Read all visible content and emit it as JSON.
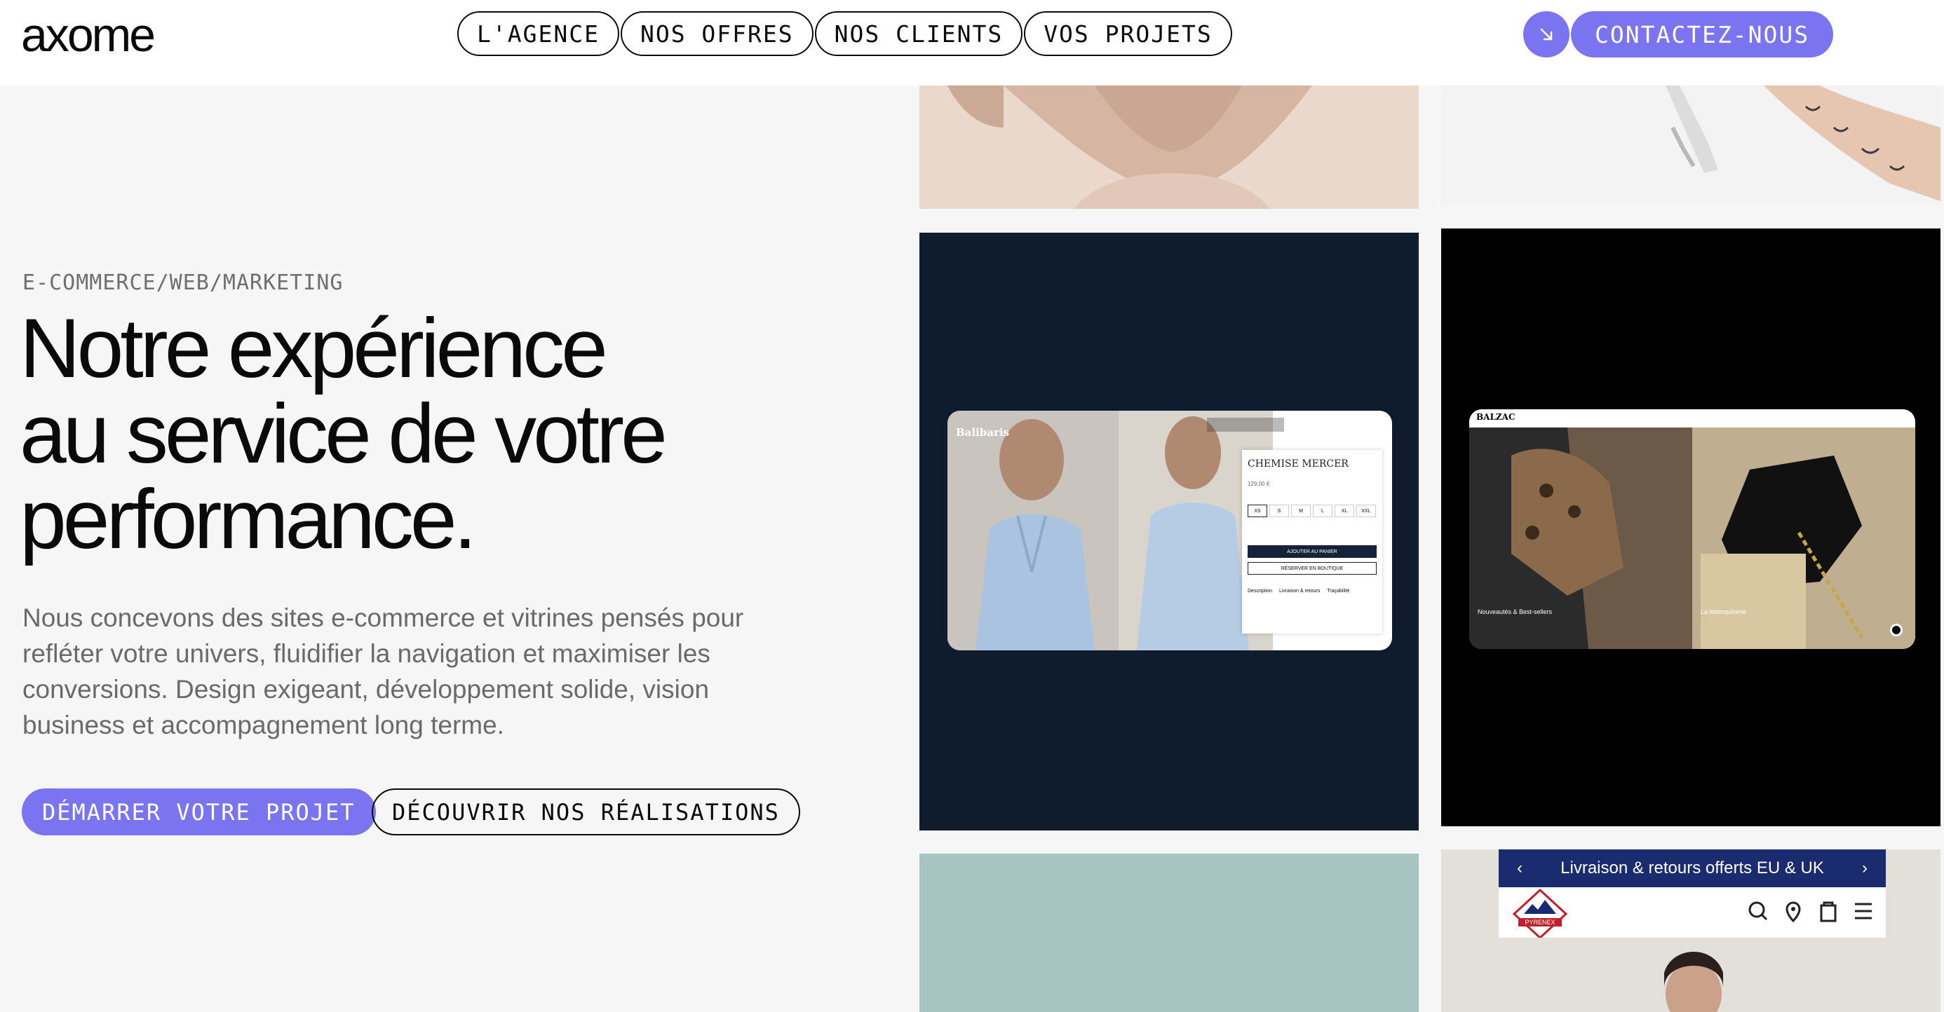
{
  "header": {
    "logo": "axome",
    "nav": [
      "L'AGENCE",
      "NOS OFFRES",
      "NOS CLIENTS",
      "VOS PROJETS"
    ],
    "contact_label": "CONTACTEZ-NOUS",
    "accent_color": "#7b74f0"
  },
  "hero": {
    "eyebrow": "E-COMMERCE/WEB/MARKETING",
    "headline_lines": [
      "Notre expérience",
      "au service de votre",
      "performance."
    ],
    "description": "Nous concevons des sites e-commerce et vitrines pensés pour refléter votre univers, fluidifier la navigation et maximiser les conversions. Design exigeant, développement solide, vision business et accompagnement long terme.",
    "cta_primary": "DÉMARRER VOTRE PROJET",
    "cta_secondary": "DÉCOUVRIR NOS RÉALISATIONS"
  },
  "gallery": {
    "balibaris": {
      "brand": "Balibaris",
      "product": "CHEMISE MERCER",
      "price": "129,00 €",
      "sizes": [
        "XS",
        "S",
        "M",
        "L",
        "XL",
        "XXL"
      ],
      "add_to_cart": "AJOUTER AU PANIER",
      "reserve": "RÉSERVER EN BOUTIQUE",
      "tabs": [
        "Description",
        "Livraison & retours",
        "Traçabilité"
      ]
    },
    "balzac": {
      "brand": "BALZAC",
      "caption_left": "Nouveautés & Best-sellers",
      "caption_right": "La Maroquinerie"
    },
    "pyrenex": {
      "announcement": "Livraison & retours offerts EU & UK",
      "brand": "PYRENEX"
    }
  },
  "icons": [
    "arrow-down-right-icon",
    "search-icon",
    "location-icon",
    "bag-icon",
    "menu-icon",
    "chevron-left-icon",
    "chevron-right-icon"
  ]
}
